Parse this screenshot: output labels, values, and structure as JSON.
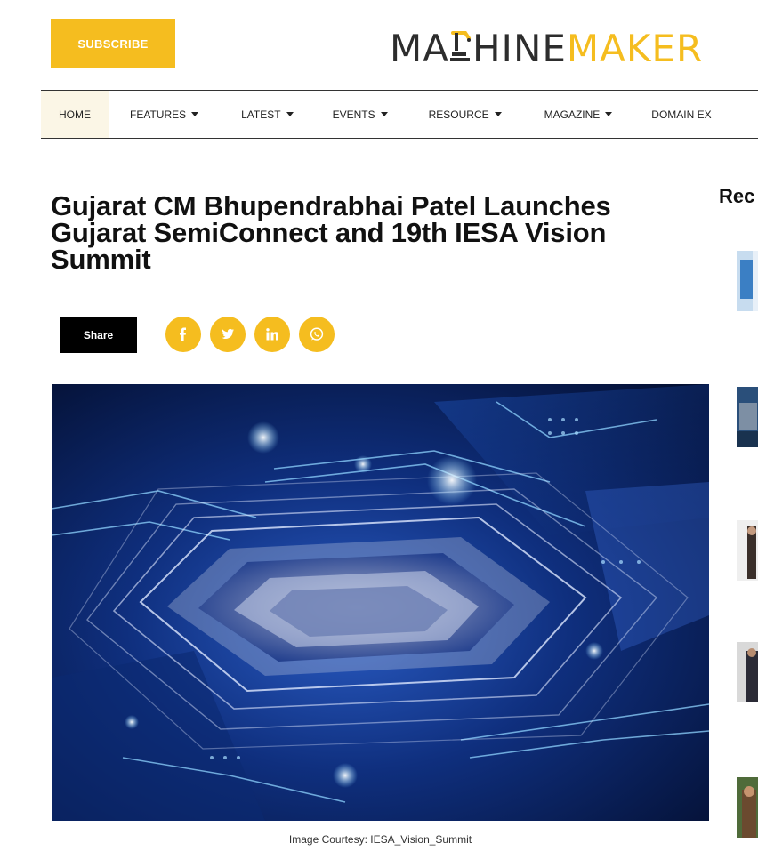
{
  "header": {
    "subscribe_label": "SUBSCRIBE",
    "logo_part1": "MA",
    "logo_part2": "HINE",
    "logo_part3": "MAKER"
  },
  "nav": {
    "items": [
      "HOME",
      "FEATURES",
      "LATEST",
      "EVENTS",
      "RESOURCE",
      "MAGAZINE",
      "DOMAIN EX"
    ]
  },
  "article": {
    "title": "Gujarat CM Bhupendrabhai Patel Launches Gujarat SemiConnect and 19th IESA Vision Summit",
    "share_label": "Share",
    "social_icons": [
      "facebook-icon",
      "twitter-icon",
      "linkedin-icon",
      "whatsapp-icon"
    ],
    "image_caption": "Image Courtesy: IESA_Vision_Summit"
  },
  "sidebar": {
    "title": "Rec"
  },
  "colors": {
    "accent": "#f5bd1f",
    "dark": "#2d2d2d",
    "nav_active_bg": "#fbf6e6"
  }
}
